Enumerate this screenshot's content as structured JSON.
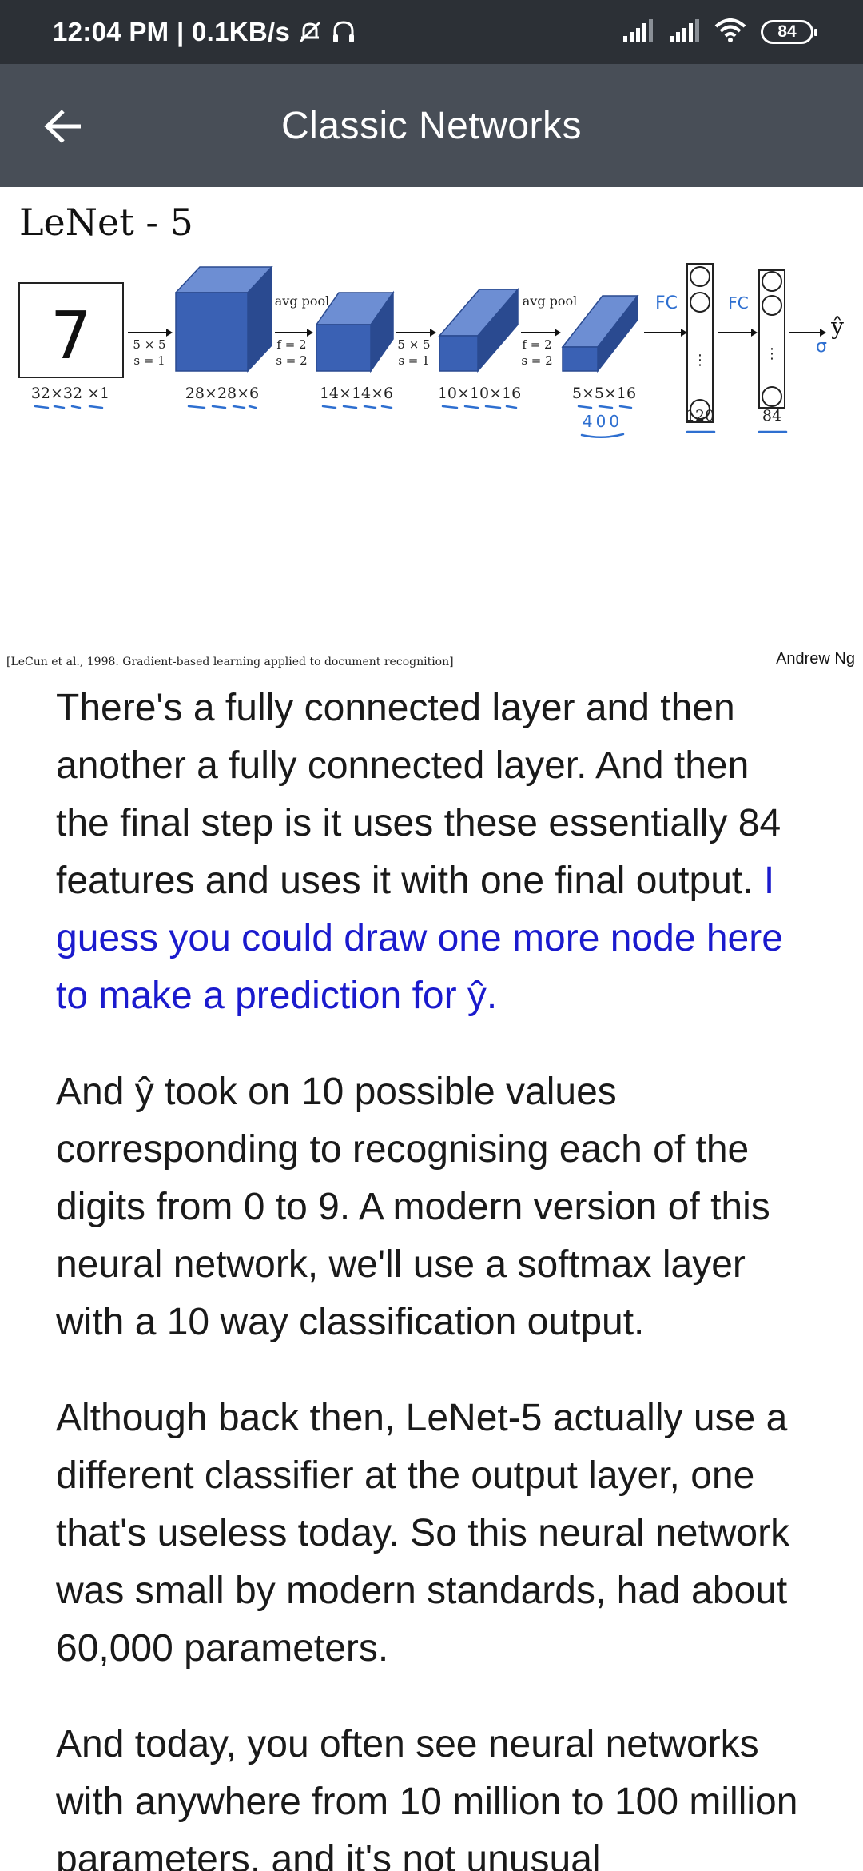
{
  "status_bar": {
    "time": "12:04 PM",
    "separator": " | ",
    "speed": "0.1KB/s",
    "battery": "84",
    "icons": [
      "mute-notifications-icon",
      "headset-icon",
      "signal-1-icon",
      "signal-2-icon",
      "wifi-icon",
      "battery-icon"
    ]
  },
  "app_bar": {
    "back_icon": "arrow-left-icon",
    "title": "Classic Networks"
  },
  "slide": {
    "title": "LeNet - 5",
    "input_digit": "7",
    "conv1_f": "5 × 5",
    "conv1_s": "s = 1",
    "pool1_label": "avg pool",
    "pool1_f": "f = 2",
    "pool1_s": "s = 2",
    "conv2_f": "5 × 5",
    "conv2_s": "s = 1",
    "pool2_label": "avg pool",
    "pool2_f": "f = 2",
    "pool2_s": "s = 2",
    "dim_input": "32×32 ×1",
    "dim_conv1": "28×28×6",
    "dim_pool1": "14×14×6",
    "dim_conv2": "10×10×16",
    "dim_pool2": "5×5×16",
    "note_400": "400",
    "fc1_note": "FC",
    "fc2_note": "FC",
    "fc1_size": "120",
    "fc2_size": "84",
    "output_label": "ŷ",
    "output_note": "σ",
    "vdots": "⋮",
    "citation": "[LeCun et al., 1998. Gradient-based learning applied to document recognition]",
    "author": "Andrew Ng",
    "colors": {
      "block_front": "#3a61b4",
      "block_top": "#6d8ed3",
      "block_side": "#2a4a90",
      "handwriting": "#2e6fd0"
    }
  },
  "transcript": {
    "p1_plain": "There's a fully connected layer and then another a fully connected layer. And then the final step is it uses these essentially 84 features and uses it with one final output. ",
    "p1_highlight": "I guess you could draw one more node here to make a prediction for ŷ.",
    "p2": "And ŷ took on 10 possible values corresponding to recognising each of the digits from 0 to 9. A modern version of this neural network, we'll use a softmax layer with a 10 way classification output.",
    "p3": "Although back then, LeNet-5 actually use a different classifier at the output layer, one that's useless today. So this neural network was small by modern standards, had about 60,000 parameters.",
    "p4": "And today, you often see neural networks with anywhere from 10 million to 100 million parameters, and it's not unusual"
  }
}
